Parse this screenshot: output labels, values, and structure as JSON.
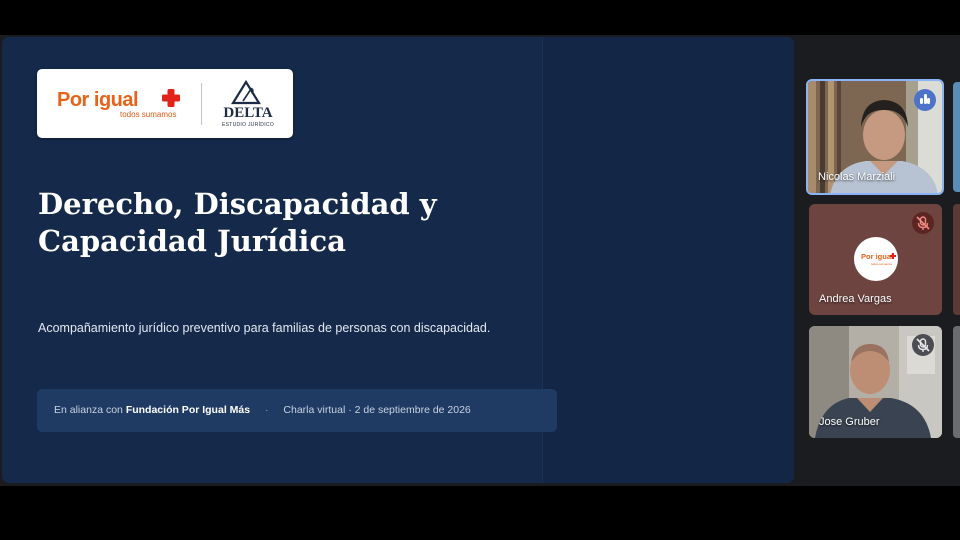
{
  "slide": {
    "logo": {
      "por_igual": "Por igual",
      "por_igual_tagline": "todos sumamos",
      "delta_name": "DELTA",
      "delta_subtitle": "ESTUDIO JURÍDICO"
    },
    "title_line1": "Derecho, Discapacidad y",
    "title_line2": "Capacidad Jurídica",
    "subtitle": "Acompañamiento jurídico preventivo para familias de personas con discapacidad.",
    "banner": {
      "prefix": "En alianza con",
      "partner": "Fundación Por Igual Más",
      "separator": "·",
      "event": "Charla virtual · 2 de septiembre de 2026"
    }
  },
  "participants": [
    {
      "name": "Nicolas Marziali",
      "status_icon": "speaking-indicator-icon",
      "active": true
    },
    {
      "name": "Andrea Vargas",
      "status_icon": "mic-off-icon",
      "avatar_logo": "Por igual",
      "avatar_tagline": "todos sumamos"
    },
    {
      "name": "Jose Gruber",
      "status_icon": "mic-off-icon"
    }
  ],
  "colors": {
    "slide_bg": "#15294a",
    "brand_orange": "#e8631a",
    "brand_red": "#e2231a",
    "active_speaker_border": "#8ab4f8"
  }
}
